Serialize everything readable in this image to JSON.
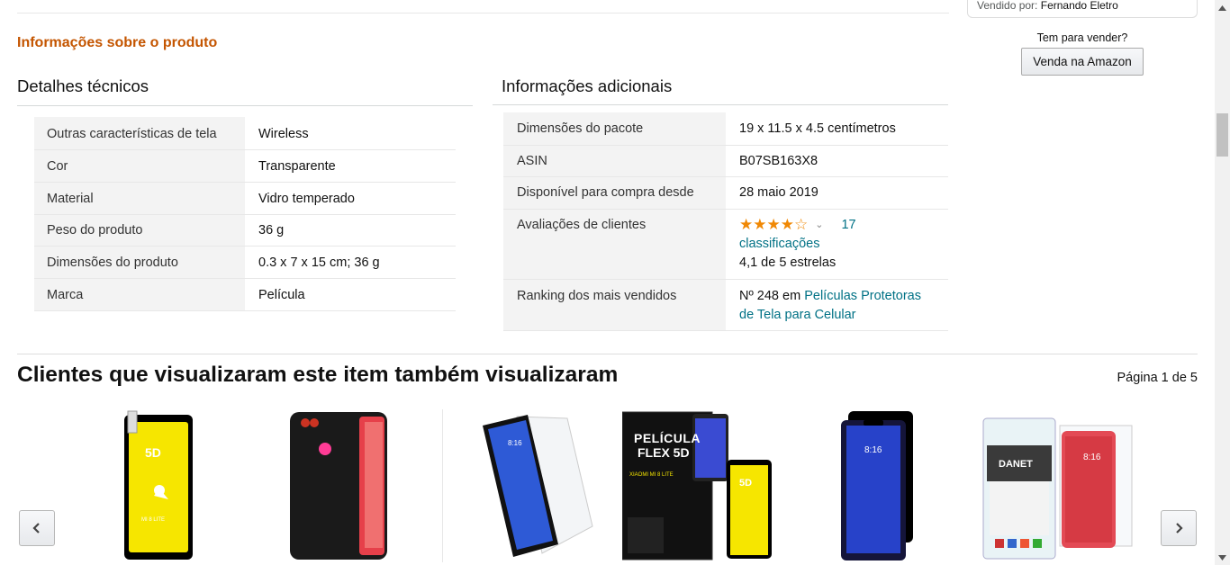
{
  "seller": {
    "sold_by_label": "Vendido por:",
    "sold_by_name": "Fernando Eletro",
    "sell_question": "Tem para vender?",
    "sell_button": "Venda na Amazon"
  },
  "product_info": {
    "title": "Informações sobre o produto",
    "technical": {
      "heading": "Detalhes técnicos",
      "rows": [
        {
          "key": "Outras características de tela",
          "value": "Wireless"
        },
        {
          "key": "Cor",
          "value": "Transparente"
        },
        {
          "key": "Material",
          "value": "Vidro temperado"
        },
        {
          "key": "Peso do produto",
          "value": "36 g"
        },
        {
          "key": "Dimensões do produto",
          "value": "0.3 x 7 x 15 cm; 36 g"
        },
        {
          "key": "Marca",
          "value": "Película"
        }
      ]
    },
    "additional": {
      "heading": "Informações adicionais",
      "rows": [
        {
          "key": "Dimensões do pacote",
          "value": "19 x 11.5 x 4.5 centímetros"
        },
        {
          "key": "ASIN",
          "value": "B07SB163X8"
        },
        {
          "key": "Disponível para compra desde",
          "value": "28 maio 2019"
        },
        {
          "key": "Avaliações de clientes",
          "rating_count_link": "17 classificações",
          "rating_count_num": "17",
          "rating_count_word": "classificações",
          "rating_text": "4,1 de 5 estrelas",
          "rating_value": 4.1
        },
        {
          "key": "Ranking dos mais vendidos",
          "rank_prefix": "Nº 248 em",
          "rank_link_1": "Películas Protetoras",
          "rank_link_2": "de Tela para Celular"
        }
      ]
    }
  },
  "carousel": {
    "title": "Clientes que visualizaram este item também visualizaram",
    "page_indicator": "Página 1 de 5",
    "products": [
      {
        "icon": "phone-film-5d-yellow-icon",
        "badge": "5D",
        "sub": "MI 8 LITE"
      },
      {
        "icon": "phone-case-black-icon"
      },
      {
        "icon": "phone-glass-film-icon"
      },
      {
        "icon": "pelicula-flex-5d-package-icon",
        "package_title_1": "PELÍCULA",
        "package_title_2": "FLEX 5D",
        "package_sub": "XIAOMI MI 8 LITE",
        "badge": "5D"
      },
      {
        "icon": "phone-black-edge-film-icon",
        "screen_time": "8:16"
      },
      {
        "icon": "danet-film-package-icon",
        "brand": "DANET",
        "screen_time": "8:16"
      }
    ]
  },
  "colors": {
    "section_title": "#c45500",
    "link": "#007185",
    "star": "#f08804",
    "key_cell_bg": "#f3f3f3"
  }
}
